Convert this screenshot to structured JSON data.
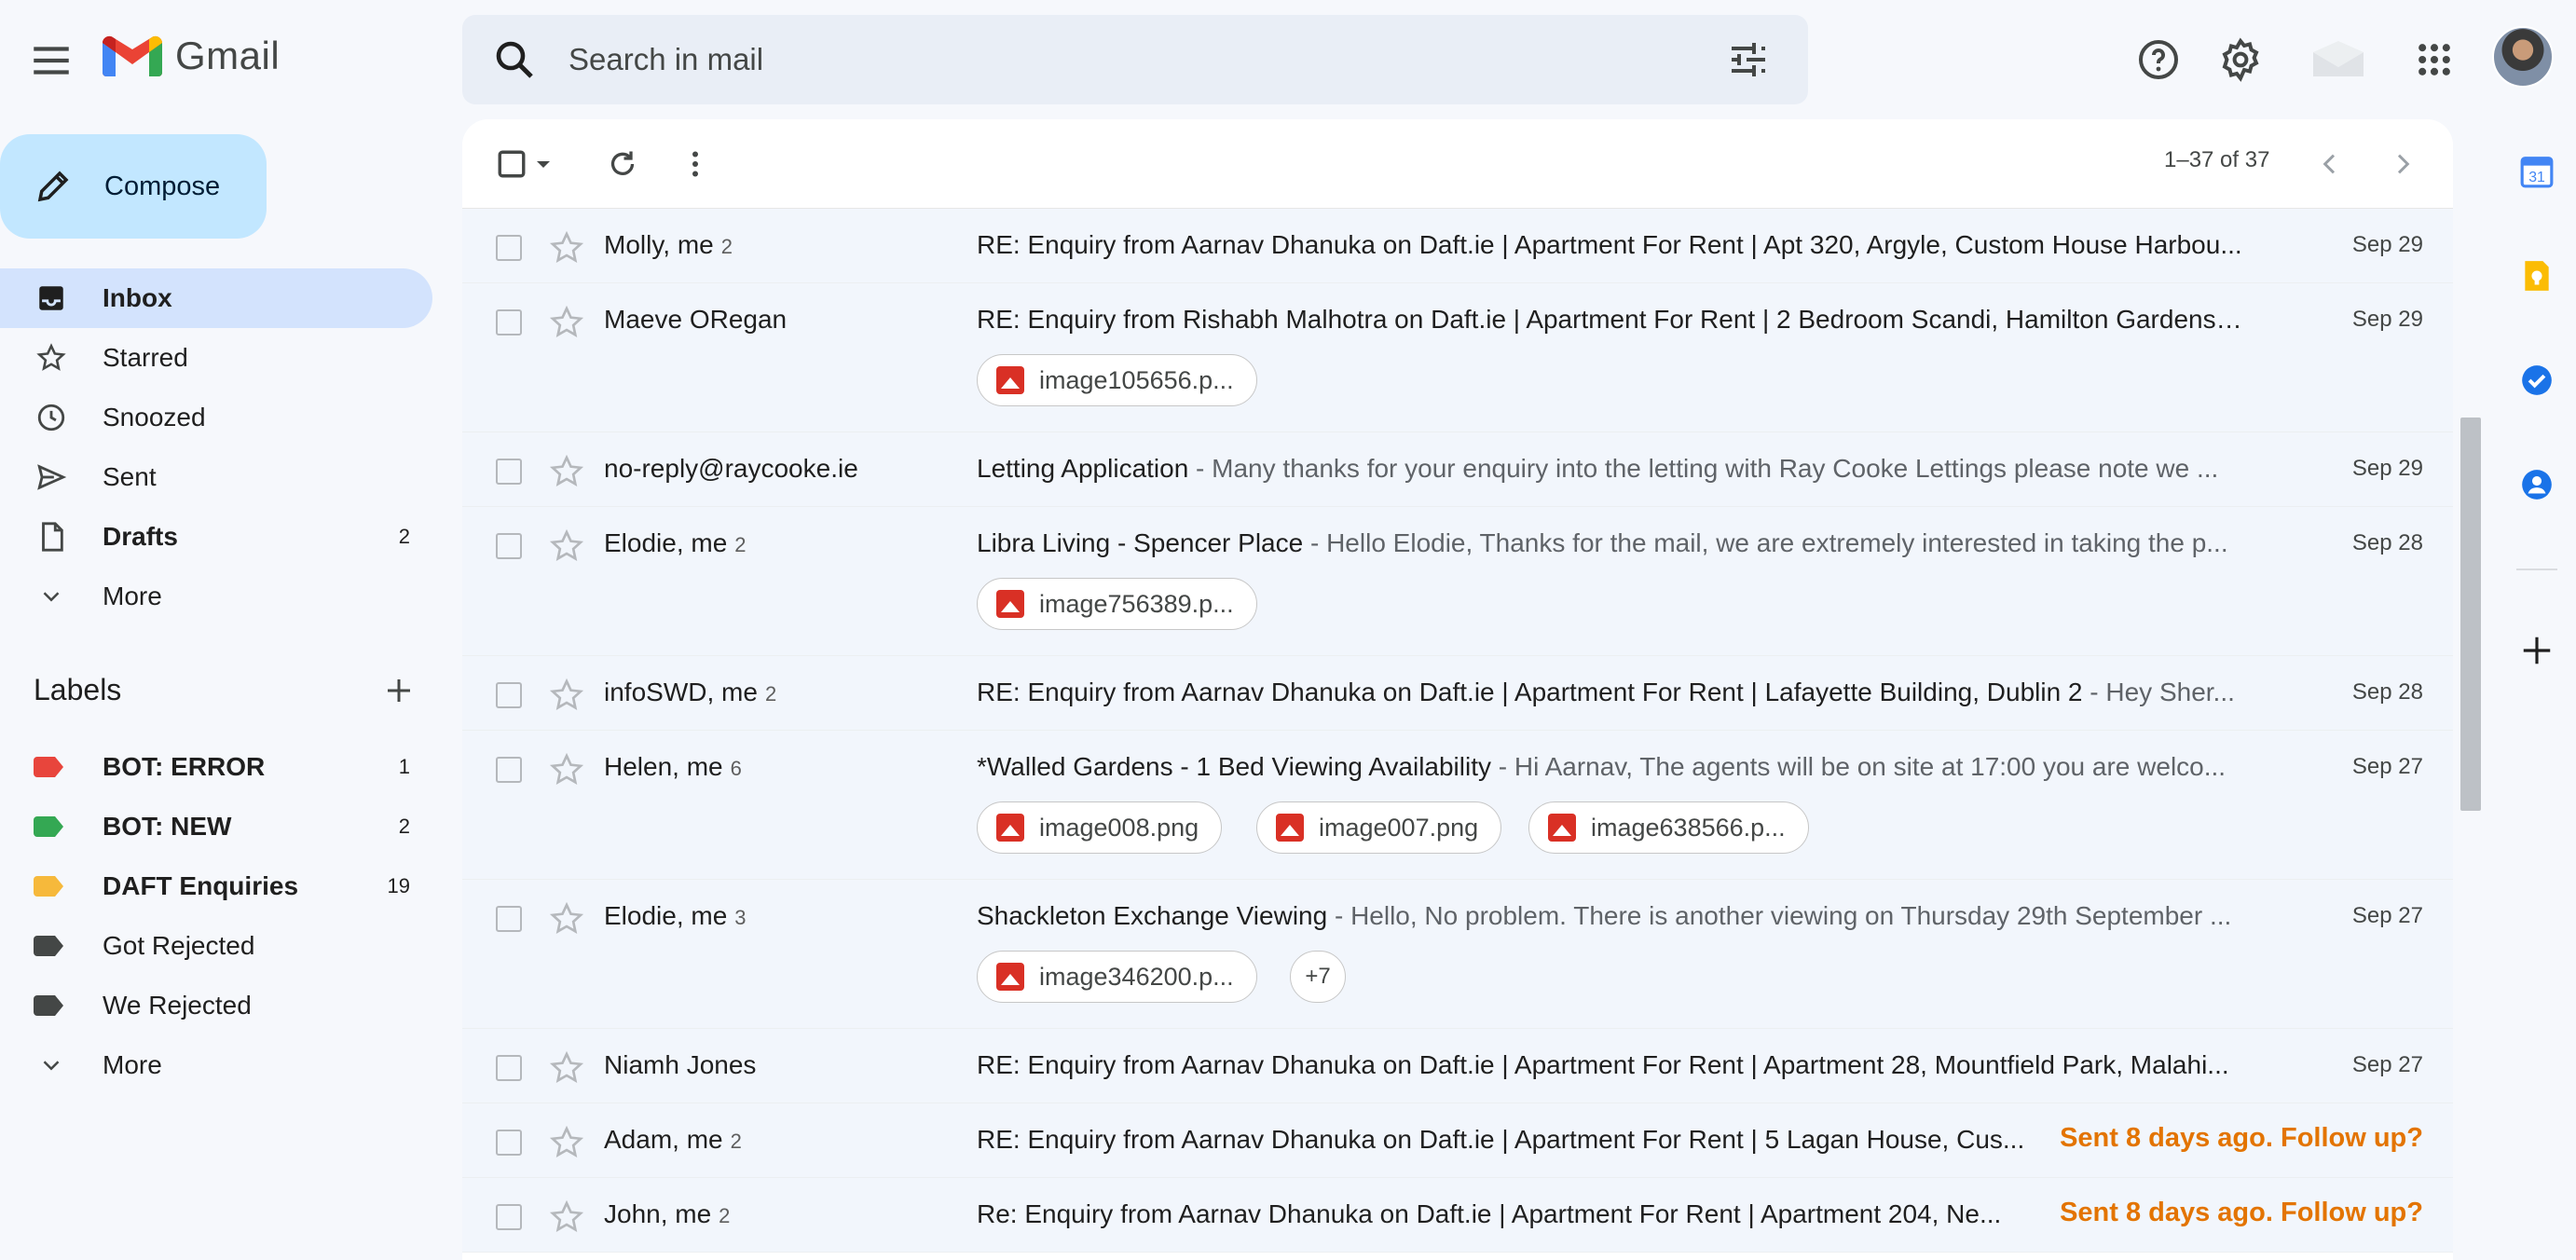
{
  "app": {
    "name": "Gmail"
  },
  "search": {
    "placeholder": "Search in mail"
  },
  "compose": {
    "label": "Compose"
  },
  "nav": [
    {
      "label": "Inbox",
      "icon": "inbox-icon",
      "count": "",
      "active": true
    },
    {
      "label": "Starred",
      "icon": "star-icon",
      "count": ""
    },
    {
      "label": "Snoozed",
      "icon": "clock-icon",
      "count": ""
    },
    {
      "label": "Sent",
      "icon": "send-icon",
      "count": ""
    },
    {
      "label": "Drafts",
      "icon": "draft-icon",
      "count": "2"
    },
    {
      "label": "More",
      "icon": "chevron-down-icon",
      "count": ""
    }
  ],
  "labels": {
    "heading": "Labels",
    "items": [
      {
        "label": "BOT: ERROR",
        "count": "1",
        "color": "#e8453c"
      },
      {
        "label": "BOT: NEW",
        "count": "2",
        "color": "#34a853"
      },
      {
        "label": "DAFT Enquiries",
        "count": "19",
        "color": "#f6b93b"
      },
      {
        "label": "Got Rejected",
        "count": "",
        "color": "#444746"
      },
      {
        "label": "We Rejected",
        "count": "",
        "color": "#444746"
      }
    ],
    "more": "More"
  },
  "toolbar": {
    "pagination": "1–37 of 37"
  },
  "emails": [
    {
      "sender": "Molly, me",
      "count": "2",
      "subject": "RE: Enquiry from Aarnav Dhanuka on Daft.ie | Apartment For Rent | Apt 320, Argyle, Custom House Harbou...",
      "snippet": "",
      "date": "Sep 29",
      "attachments": []
    },
    {
      "sender": "Maeve ORegan",
      "count": "",
      "subject": "RE: Enquiry from Rishabh Malhotra on Daft.ie | Apartment For Rent | 2 Bedroom Scandi, Hamilton Gardens,...",
      "snippet": "",
      "date": "Sep 29",
      "attachments": [
        "image105656.p..."
      ]
    },
    {
      "sender": "no-reply@raycooke.ie",
      "count": "",
      "subject": "Letting Application",
      "snippet": " - Many thanks for your enquiry into the letting with Ray Cooke Lettings please note we ...",
      "date": "Sep 29",
      "attachments": []
    },
    {
      "sender": "Elodie, me",
      "count": "2",
      "subject": "Libra Living - Spencer Place",
      "snippet": " - Hello Elodie, Thanks for the mail, we are extremely interested in taking the p...",
      "date": "Sep 28",
      "attachments": [
        "image756389.p..."
      ]
    },
    {
      "sender": "infoSWD, me",
      "count": "2",
      "subject": "RE: Enquiry from Aarnav Dhanuka on Daft.ie | Apartment For Rent | Lafayette Building, Dublin 2",
      "snippet": " - Hey Sher...",
      "date": "Sep 28",
      "attachments": []
    },
    {
      "sender": "Helen, me",
      "count": "6",
      "subject": "*Walled Gardens - 1 Bed Viewing Availability",
      "snippet": " - Hi Aarnav, The agents will be on site at 17:00 you are welco...",
      "date": "Sep 27",
      "attachments": [
        "image008.png",
        "image007.png",
        "image638566.p..."
      ]
    },
    {
      "sender": "Elodie, me",
      "count": "3",
      "subject": "Shackleton Exchange Viewing",
      "snippet": " - Hello, No problem. There is another viewing on Thursday 29th September ...",
      "date": "Sep 27",
      "attachments": [
        "image346200.p..."
      ],
      "more": "+7"
    },
    {
      "sender": "Niamh Jones",
      "count": "",
      "subject": "RE: Enquiry from Aarnav Dhanuka on Daft.ie | Apartment For Rent | Apartment 28, Mountfield Park, Malahi...",
      "snippet": "",
      "date": "Sep 27",
      "attachments": []
    },
    {
      "sender": "Adam, me",
      "count": "2",
      "subject": "RE: Enquiry from Aarnav Dhanuka on Daft.ie | Apartment For Rent | 5 Lagan House, Cus...",
      "snippet": "",
      "date": "",
      "followup": "Sent 8 days ago. Follow up?",
      "attachments": []
    },
    {
      "sender": "John, me",
      "count": "2",
      "subject": "Re: Enquiry from Aarnav Dhanuka on Daft.ie | Apartment For Rent | Apartment 204, Ne...",
      "snippet": "",
      "date": "",
      "followup": "Sent 8 days ago. Follow up?",
      "attachments": []
    }
  ]
}
